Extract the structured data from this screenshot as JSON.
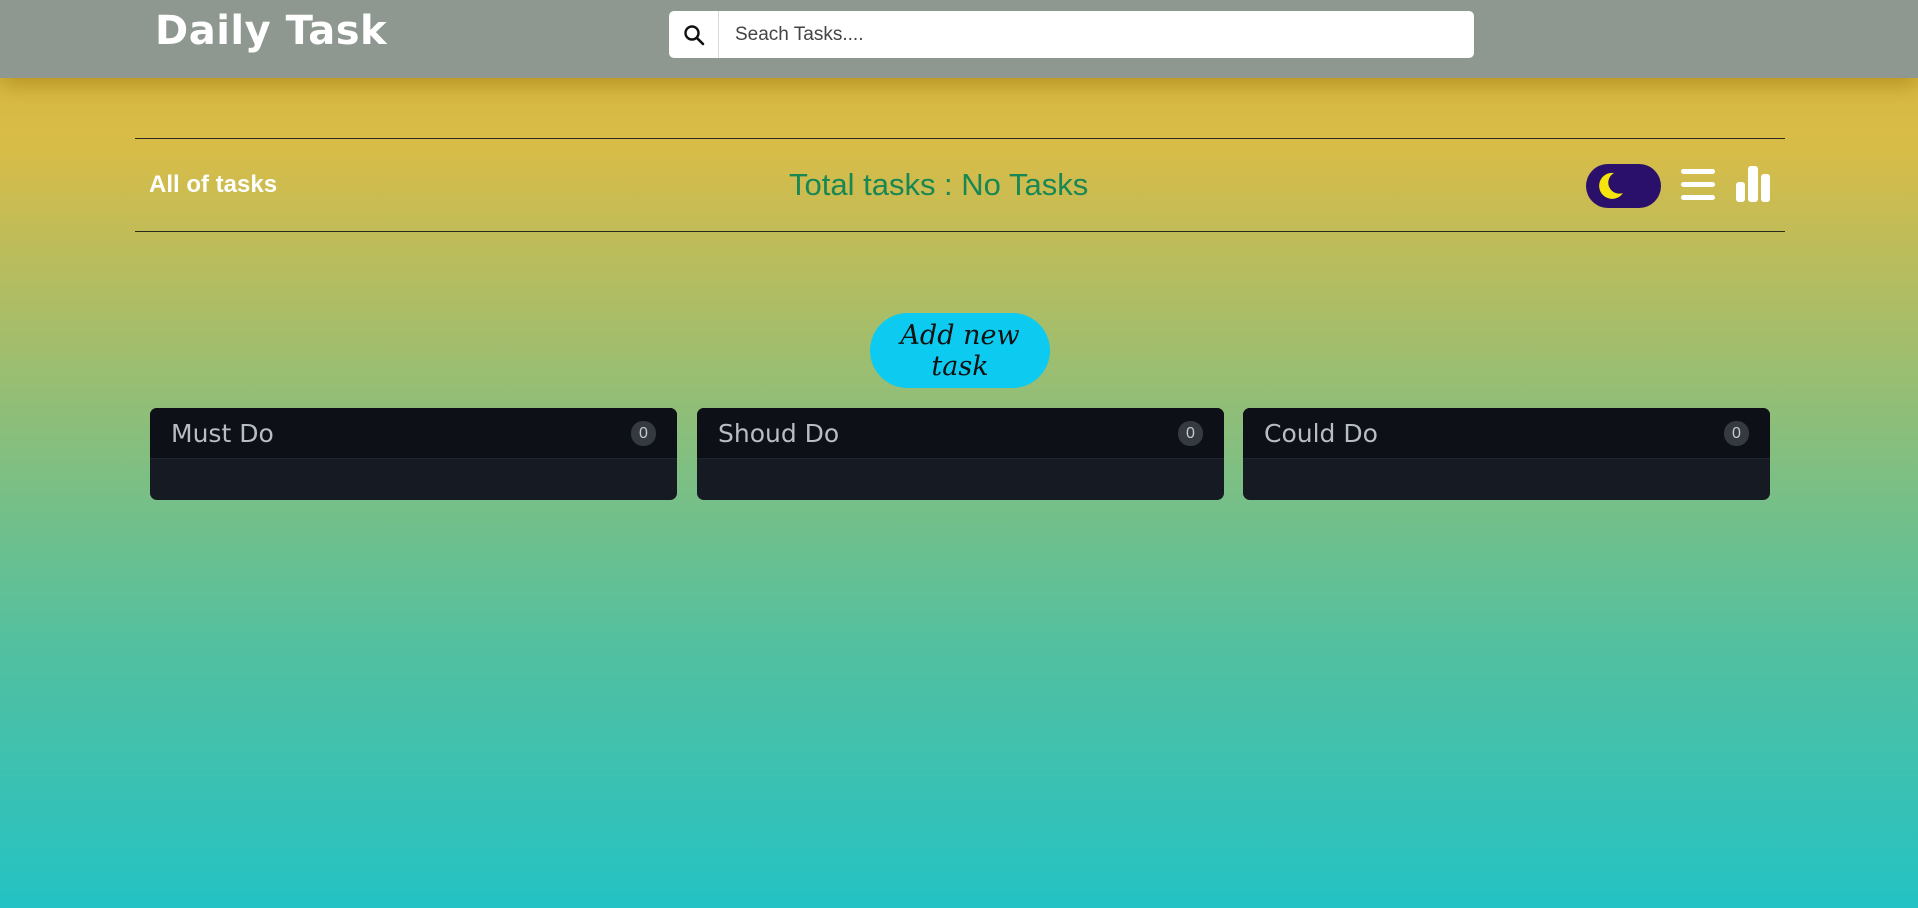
{
  "navbar": {
    "brand": "Daily Task",
    "search": {
      "placeholder": "Seach Tasks....",
      "icon": "search-icon"
    }
  },
  "toolbar": {
    "heading": "All of tasks",
    "total_text": "Total tasks : No Tasks",
    "theme_toggle": {
      "icon": "moon-icon",
      "state": "dark"
    },
    "list_view_icon": "menu-icon",
    "chart_view_icon": "bar-chart-icon"
  },
  "add_button_label": "Add new task",
  "columns": [
    {
      "title": "Must Do",
      "count": "0"
    },
    {
      "title": "Shoud Do",
      "count": "0"
    },
    {
      "title": "Could Do",
      "count": "0"
    }
  ],
  "colors": {
    "navbar": "#8e9890",
    "total_text": "#198754",
    "add_button": "#0dcaf0",
    "toggle": "#2a0f6b",
    "moon": "#f5e50a",
    "card": "#161a22"
  }
}
